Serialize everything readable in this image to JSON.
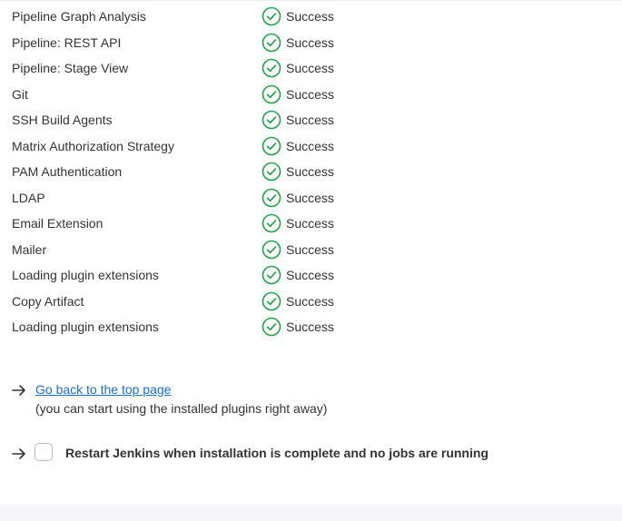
{
  "plugins": [
    {
      "name": "Pipeline Graph Analysis",
      "status": "Success"
    },
    {
      "name": "Pipeline: REST API",
      "status": "Success"
    },
    {
      "name": "Pipeline: Stage View",
      "status": "Success"
    },
    {
      "name": "Git",
      "status": "Success"
    },
    {
      "name": "SSH Build Agents",
      "status": "Success"
    },
    {
      "name": "Matrix Authorization Strategy",
      "status": "Success"
    },
    {
      "name": "PAM Authentication",
      "status": "Success"
    },
    {
      "name": "LDAP",
      "status": "Success"
    },
    {
      "name": "Email Extension",
      "status": "Success"
    },
    {
      "name": "Mailer",
      "status": "Success"
    },
    {
      "name": "Loading plugin extensions",
      "status": "Success"
    },
    {
      "name": "Copy Artifact",
      "status": "Success"
    },
    {
      "name": "Loading plugin extensions",
      "status": "Success"
    }
  ],
  "icons": {
    "status": "check-circle-icon",
    "link_arrow": "arrow-right-icon"
  },
  "colors": {
    "success": "#1ea446",
    "link": "#1a6ecf",
    "text": "#333333"
  },
  "actions": {
    "back_link_label": "Go back to the top page",
    "back_link_note": "(you can start using the installed plugins right away)",
    "restart_label": "Restart Jenkins when installation is complete and no jobs are running",
    "restart_checked": false
  }
}
